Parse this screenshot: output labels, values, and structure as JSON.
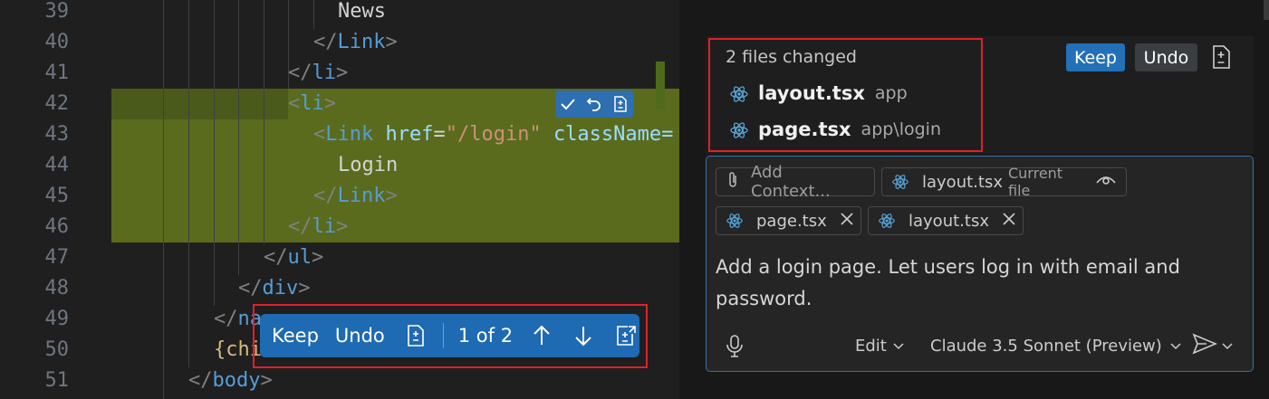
{
  "editor": {
    "lines": [
      {
        "num": "39",
        "text": "News"
      },
      {
        "num": "40",
        "tag": "Link"
      },
      {
        "num": "41",
        "tag": "li"
      },
      {
        "num": "42",
        "tag": "li"
      },
      {
        "num": "43",
        "tag": "Link",
        "attr": "href",
        "value": "\"/login\"",
        "attr2": "className="
      },
      {
        "num": "44",
        "text": "Login"
      },
      {
        "num": "45",
        "tag": "Link"
      },
      {
        "num": "46",
        "tag": "li"
      },
      {
        "num": "47",
        "tag": "ul"
      },
      {
        "num": "48",
        "tag": "div"
      },
      {
        "num": "49",
        "tag": "na"
      },
      {
        "num": "50",
        "text": "{chi"
      },
      {
        "num": "51",
        "tag": "body"
      }
    ],
    "colors": {
      "highlight": "#5a6b1e",
      "tag": "#569cd6",
      "attribute": "#9cdcfe",
      "string": "#ce9178"
    }
  },
  "inline_actions": {
    "icons": [
      "check-icon",
      "undo-arrow-icon",
      "diff-file-icon"
    ]
  },
  "review_bar": {
    "keep": "Keep",
    "undo": "Undo",
    "counter": "1 of 2",
    "icons": [
      "diff-file-icon",
      "arrow-up-icon",
      "arrow-down-icon",
      "open-diff-icon"
    ],
    "accent": "#1e6ab3"
  },
  "changes": {
    "title": "2 files changed",
    "keep": "Keep",
    "undo": "Undo",
    "files": [
      {
        "name": "layout.tsx",
        "path": "app"
      },
      {
        "name": "page.tsx",
        "path": "app\\login"
      }
    ]
  },
  "chat": {
    "add_context": "Add Context...",
    "current_file": {
      "name": "layout.tsx",
      "note": "Current file"
    },
    "attachments": [
      {
        "name": "page.tsx"
      },
      {
        "name": "layout.tsx"
      }
    ],
    "message": "Add a login page. Let users log in with email and password.",
    "mode": "Edit",
    "model": "Claude 3.5 Sonnet (Preview)"
  }
}
